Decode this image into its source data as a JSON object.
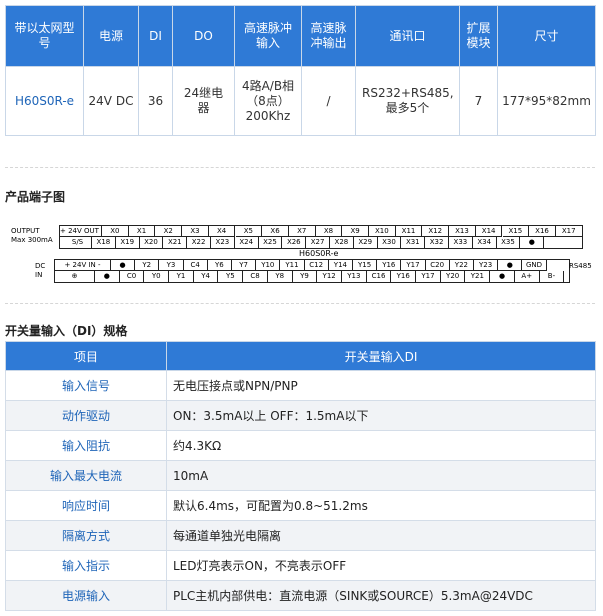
{
  "spec_table": {
    "headers": [
      "带以太网型号",
      "电源",
      "DI",
      "DO",
      "高速脉冲输入",
      "高速脉冲输出",
      "通讯口",
      "扩展模块",
      "尺寸"
    ],
    "row": [
      "H60S0R-e",
      "24V DC",
      "36",
      "24继电器",
      "4路A/B相（8点）200Khz",
      "/",
      "RS232+RS485, 最多5个",
      "7",
      "177*95*82mm"
    ]
  },
  "terminal_section": {
    "title": "产品端子图",
    "output_label": "OUTPUT",
    "max_label": "Max 300mA",
    "model_label": "H60S0R-e",
    "dc_label": "DC",
    "in_label": "IN",
    "rs485_label": "RS485",
    "top_upper": [
      "+ 24V OUT -",
      "X0",
      "X1",
      "X2",
      "X3",
      "X4",
      "X5",
      "X6",
      "X7",
      "X8",
      "X9",
      "X10",
      "X11",
      "X12",
      "X13",
      "X14",
      "X15",
      "X16",
      "X17"
    ],
    "top_lower": [
      "S/S",
      "X18",
      "X19",
      "X20",
      "X21",
      "X22",
      "X23",
      "X24",
      "X25",
      "X26",
      "X27",
      "X28",
      "X29",
      "X30",
      "X31",
      "X32",
      "X33",
      "X34",
      "X35",
      "●"
    ],
    "bot_upper": [
      "+ 24V IN -",
      "●",
      "Y2",
      "Y3",
      "C4",
      "Y6",
      "Y7",
      "Y10",
      "Y11",
      "C12",
      "Y14",
      "Y15",
      "Y16",
      "Y17",
      "C20",
      "Y22",
      "Y23",
      "●",
      "GND"
    ],
    "bot_lower": [
      "⊕",
      "●",
      "C0",
      "Y0",
      "Y1",
      "Y4",
      "Y5",
      "C8",
      "Y8",
      "Y9",
      "Y12",
      "Y13",
      "C16",
      "Y16",
      "Y17",
      "Y20",
      "Y21",
      "●",
      "A+",
      "B-"
    ]
  },
  "di_section": {
    "title": "开关量输入（DI）规格",
    "headers": [
      "项目",
      "开关量输入DI"
    ],
    "rows": [
      {
        "item": "输入信号",
        "value": "无电压接点或NPN/PNP"
      },
      {
        "item": "动作驱动",
        "value": "ON：3.5mA以上  OFF：1.5mA以下"
      },
      {
        "item": "输入阻抗",
        "value": "约4.3KΩ"
      },
      {
        "item": "输入最大电流",
        "value": "10mA"
      },
      {
        "item": "响应时间",
        "value": "默认6.4ms，可配置为0.8~51.2ms"
      },
      {
        "item": "隔离方式",
        "value": "每通道单独光电隔离"
      },
      {
        "item": "输入指示",
        "value": "LED灯亮表示ON，不亮表示OFF"
      },
      {
        "item": "电源输入",
        "value": "PLC主机内部供电：直流电源（SINK或SOURCE）5.3mA@24VDC"
      }
    ]
  },
  "colors": {
    "header_bg": "#2f7ad6",
    "link_blue": "#1f65b8",
    "alt_row": "#f1f3f6"
  }
}
